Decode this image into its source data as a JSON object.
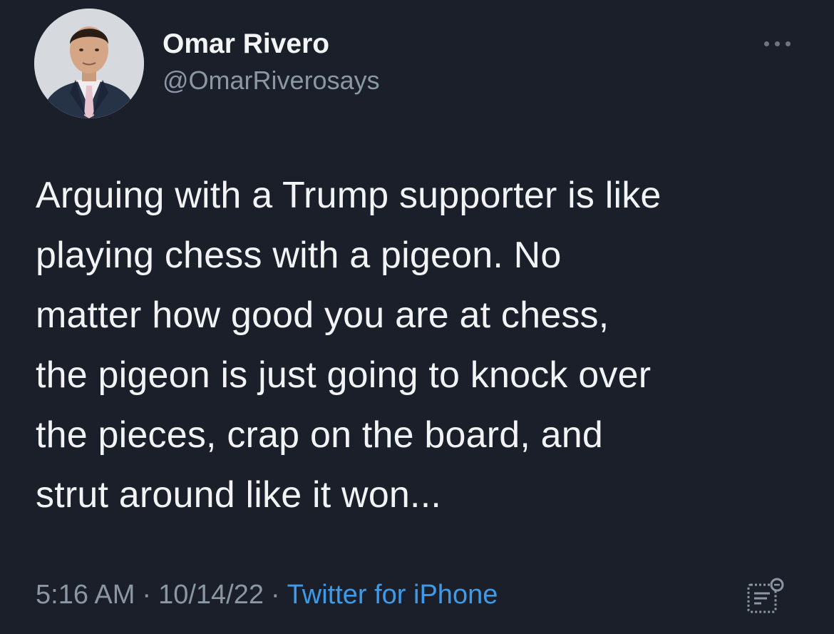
{
  "author": {
    "display_name": "Omar Rivero",
    "handle": "@OmarRiverosays"
  },
  "tweet": {
    "text": "Arguing with a Trump supporter is like\nplaying chess with a pigeon. No\nmatter how good you are at chess,\nthe pigeon is just going to knock over\nthe pieces, crap on the board, and\nstrut around like it won...",
    "time": "5:16 AM",
    "date": "10/14/22",
    "separator": "·",
    "source": "Twitter for iPhone"
  },
  "icons": {
    "more": "more-horizontal-icon",
    "analytics": "view-tweet-analytics-icon"
  },
  "colors": {
    "background": "#1a1f29",
    "primary_text": "#f1f3f4",
    "secondary_text": "#8b97a3",
    "link": "#3d9be9"
  }
}
